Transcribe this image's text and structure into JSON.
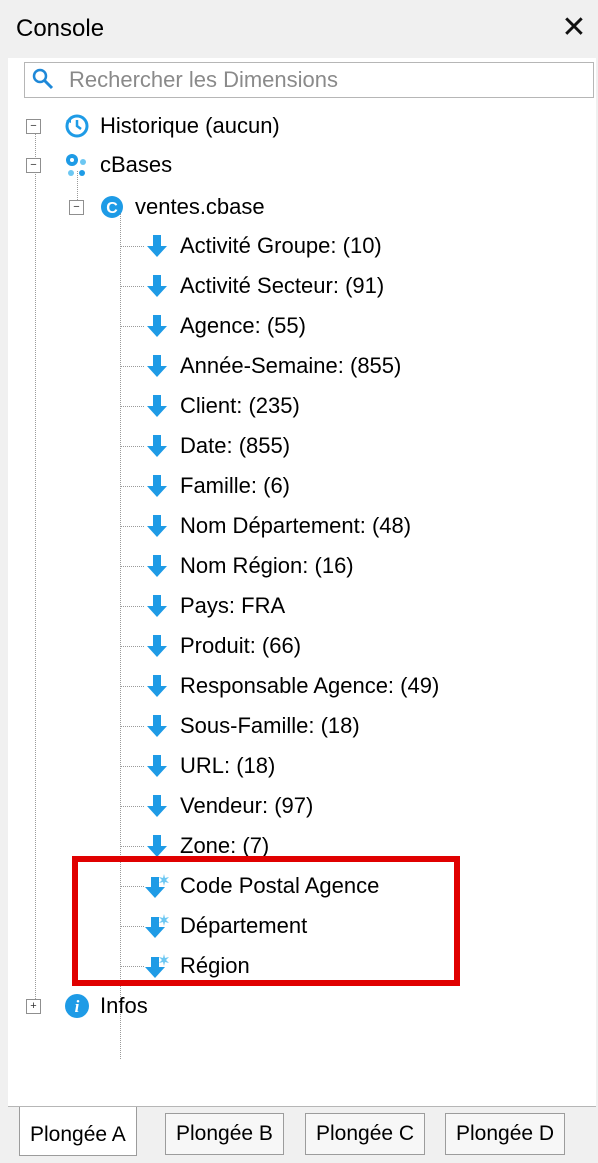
{
  "panel": {
    "title": "Console"
  },
  "search": {
    "placeholder": "Rechercher les Dimensions"
  },
  "tree": {
    "history": "Historique (aucun)",
    "cbases": "cBases",
    "ventes": "ventes.cbase",
    "dimensions": [
      "Activité Groupe: (10)",
      "Activité Secteur: (91)",
      "Agence: (55)",
      "Année-Semaine: (855)",
      "Client: (235)",
      "Date: (855)",
      "Famille: (6)",
      "Nom Département: (48)",
      "Nom Région: (16)",
      "Pays: FRA",
      "Produit: (66)",
      "Responsable Agence: (49)",
      "Sous-Famille: (18)",
      "URL: (18)",
      "Vendeur: (97)",
      "Zone: (7)"
    ],
    "computed": [
      "Code Postal Agence",
      "Département",
      "Région"
    ],
    "infos": "Infos"
  },
  "tabs": [
    "Plongée A",
    "Plongée B",
    "Plongée C",
    "Plongée D"
  ],
  "colors": {
    "accent": "#1e9be6",
    "highlight": "#e00000"
  }
}
